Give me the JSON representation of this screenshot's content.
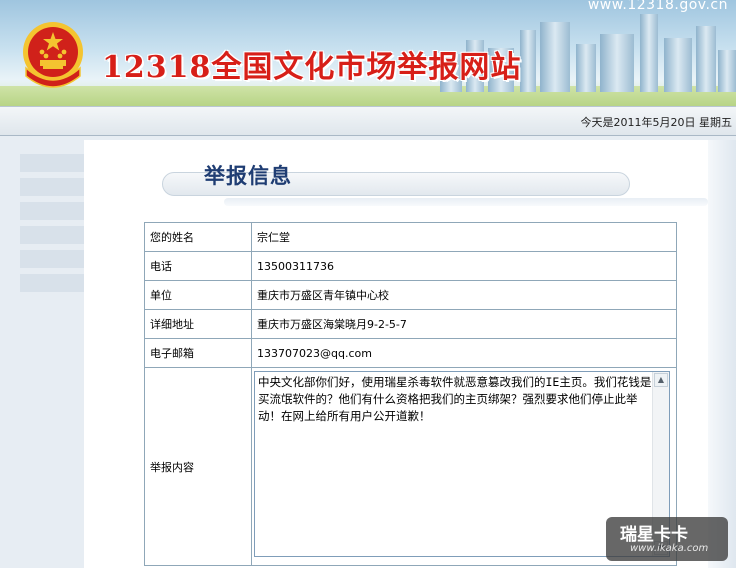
{
  "header": {
    "url": "www.12318.gov.cn",
    "title": "12318全国文化市场举报网站",
    "colors": {
      "title": "#d71f18",
      "banner_sky": "#b7d6ea",
      "emblem_red": "#d0211a",
      "emblem_gold": "#f4c430"
    }
  },
  "datebar": {
    "text": "今天是2011年5月20日  星期五"
  },
  "section": {
    "title": "举报信息",
    "title_color": "#1f3d73"
  },
  "form": {
    "rows": [
      {
        "label": "您的姓名",
        "value": "宗仁堂"
      },
      {
        "label": "电话",
        "value": "13500311736"
      },
      {
        "label": "单位",
        "value": "重庆市万盛区青年镇中心校"
      },
      {
        "label": "详细地址",
        "value": "重庆市万盛区海棠晓月9-2-5-7"
      },
      {
        "label": "电子邮箱",
        "value": "133707023@qq.com"
      }
    ],
    "content": {
      "label": "举报内容",
      "value": "中央文化部你们好，使用瑞星杀毒软件就恶意篡改我们的IE主页。我们花钱是买流氓软件的？他们有什么资格把我们的主页绑架？强烈要求他们停止此举动！在网上给所有用户公开道歉！"
    }
  },
  "watermark": {
    "title": "瑞星卡卡",
    "url": "www.ikaka.com"
  }
}
